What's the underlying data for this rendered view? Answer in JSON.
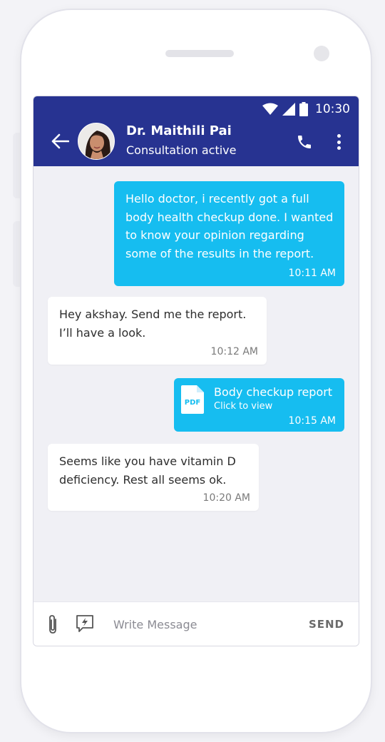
{
  "status_bar": {
    "time": "10:30"
  },
  "header": {
    "contact_name": "Dr. Maithili Pai",
    "contact_status": "Consultation active"
  },
  "colors": {
    "header_bg": "#273391",
    "sent_bubble": "#16bdf0",
    "received_bubble": "#ffffff",
    "chat_bg": "#f0f0f5"
  },
  "messages": [
    {
      "direction": "sent",
      "text": "Hello doctor, i recently got a full\nbody health checkup done. I wanted\nto know your opinion regarding\nsome of the results in the report.",
      "time": "10:11 AM"
    },
    {
      "direction": "received",
      "text": "Hey akshay. Send me the report.\nI’ll have a look.",
      "time": "10:12 AM"
    },
    {
      "direction": "sent",
      "type": "attachment",
      "icon_label": "PDF",
      "title": "Body checkup report",
      "subtitle": "Click to view",
      "time": "10:15 AM"
    },
    {
      "direction": "received",
      "text": "Seems like you have vitamin D\ndeficiency. Rest all seems ok.",
      "time": "10:20 AM"
    }
  ],
  "composer": {
    "placeholder": "Write Message",
    "send_label": "SEND",
    "icons": [
      "paperclip-icon",
      "quick-reply-icon"
    ]
  }
}
